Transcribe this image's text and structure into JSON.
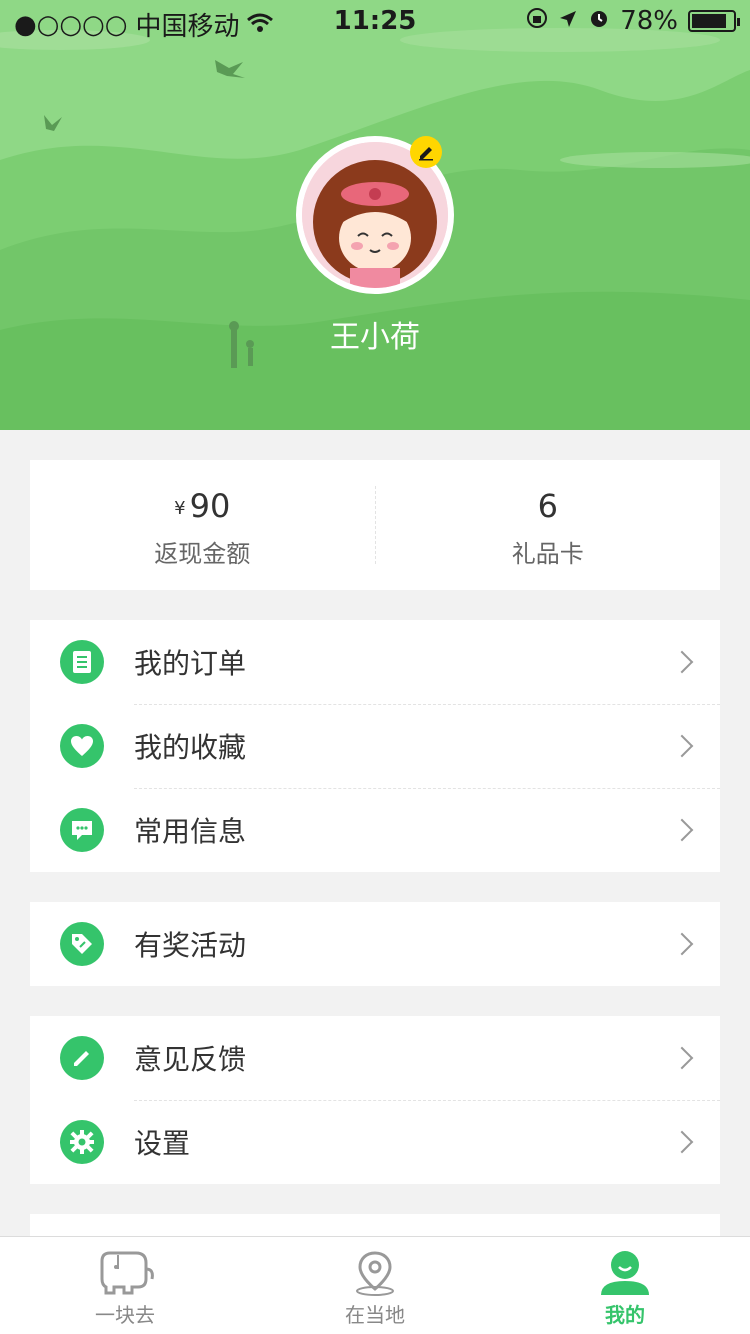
{
  "status_bar": {
    "signal": "●○○○○",
    "carrier": "中国移动",
    "time": "11:25",
    "battery": "78%"
  },
  "profile": {
    "username": "王小荷"
  },
  "stats": [
    {
      "currency": "¥",
      "value": "90",
      "label": "返现金额"
    },
    {
      "value": "6",
      "label": "礼品卡"
    }
  ],
  "menu": {
    "group1": [
      {
        "label": "我的订单",
        "icon": "order-icon"
      },
      {
        "label": "我的收藏",
        "icon": "heart-icon"
      },
      {
        "label": "常用信息",
        "icon": "chat-icon"
      }
    ],
    "group2": [
      {
        "label": "有奖活动",
        "icon": "tag-icon"
      }
    ],
    "group3": [
      {
        "label": "意见反馈",
        "icon": "pencil-icon"
      },
      {
        "label": "设置",
        "icon": "gear-icon"
      }
    ]
  },
  "tabbar": [
    {
      "label": "一块去",
      "icon": "elephant-icon",
      "active": false
    },
    {
      "label": "在当地",
      "icon": "location-icon",
      "active": false
    },
    {
      "label": "我的",
      "icon": "person-icon",
      "active": true
    }
  ],
  "colors": {
    "accent": "#35c46b",
    "hero_bg": "#7ccd74"
  }
}
